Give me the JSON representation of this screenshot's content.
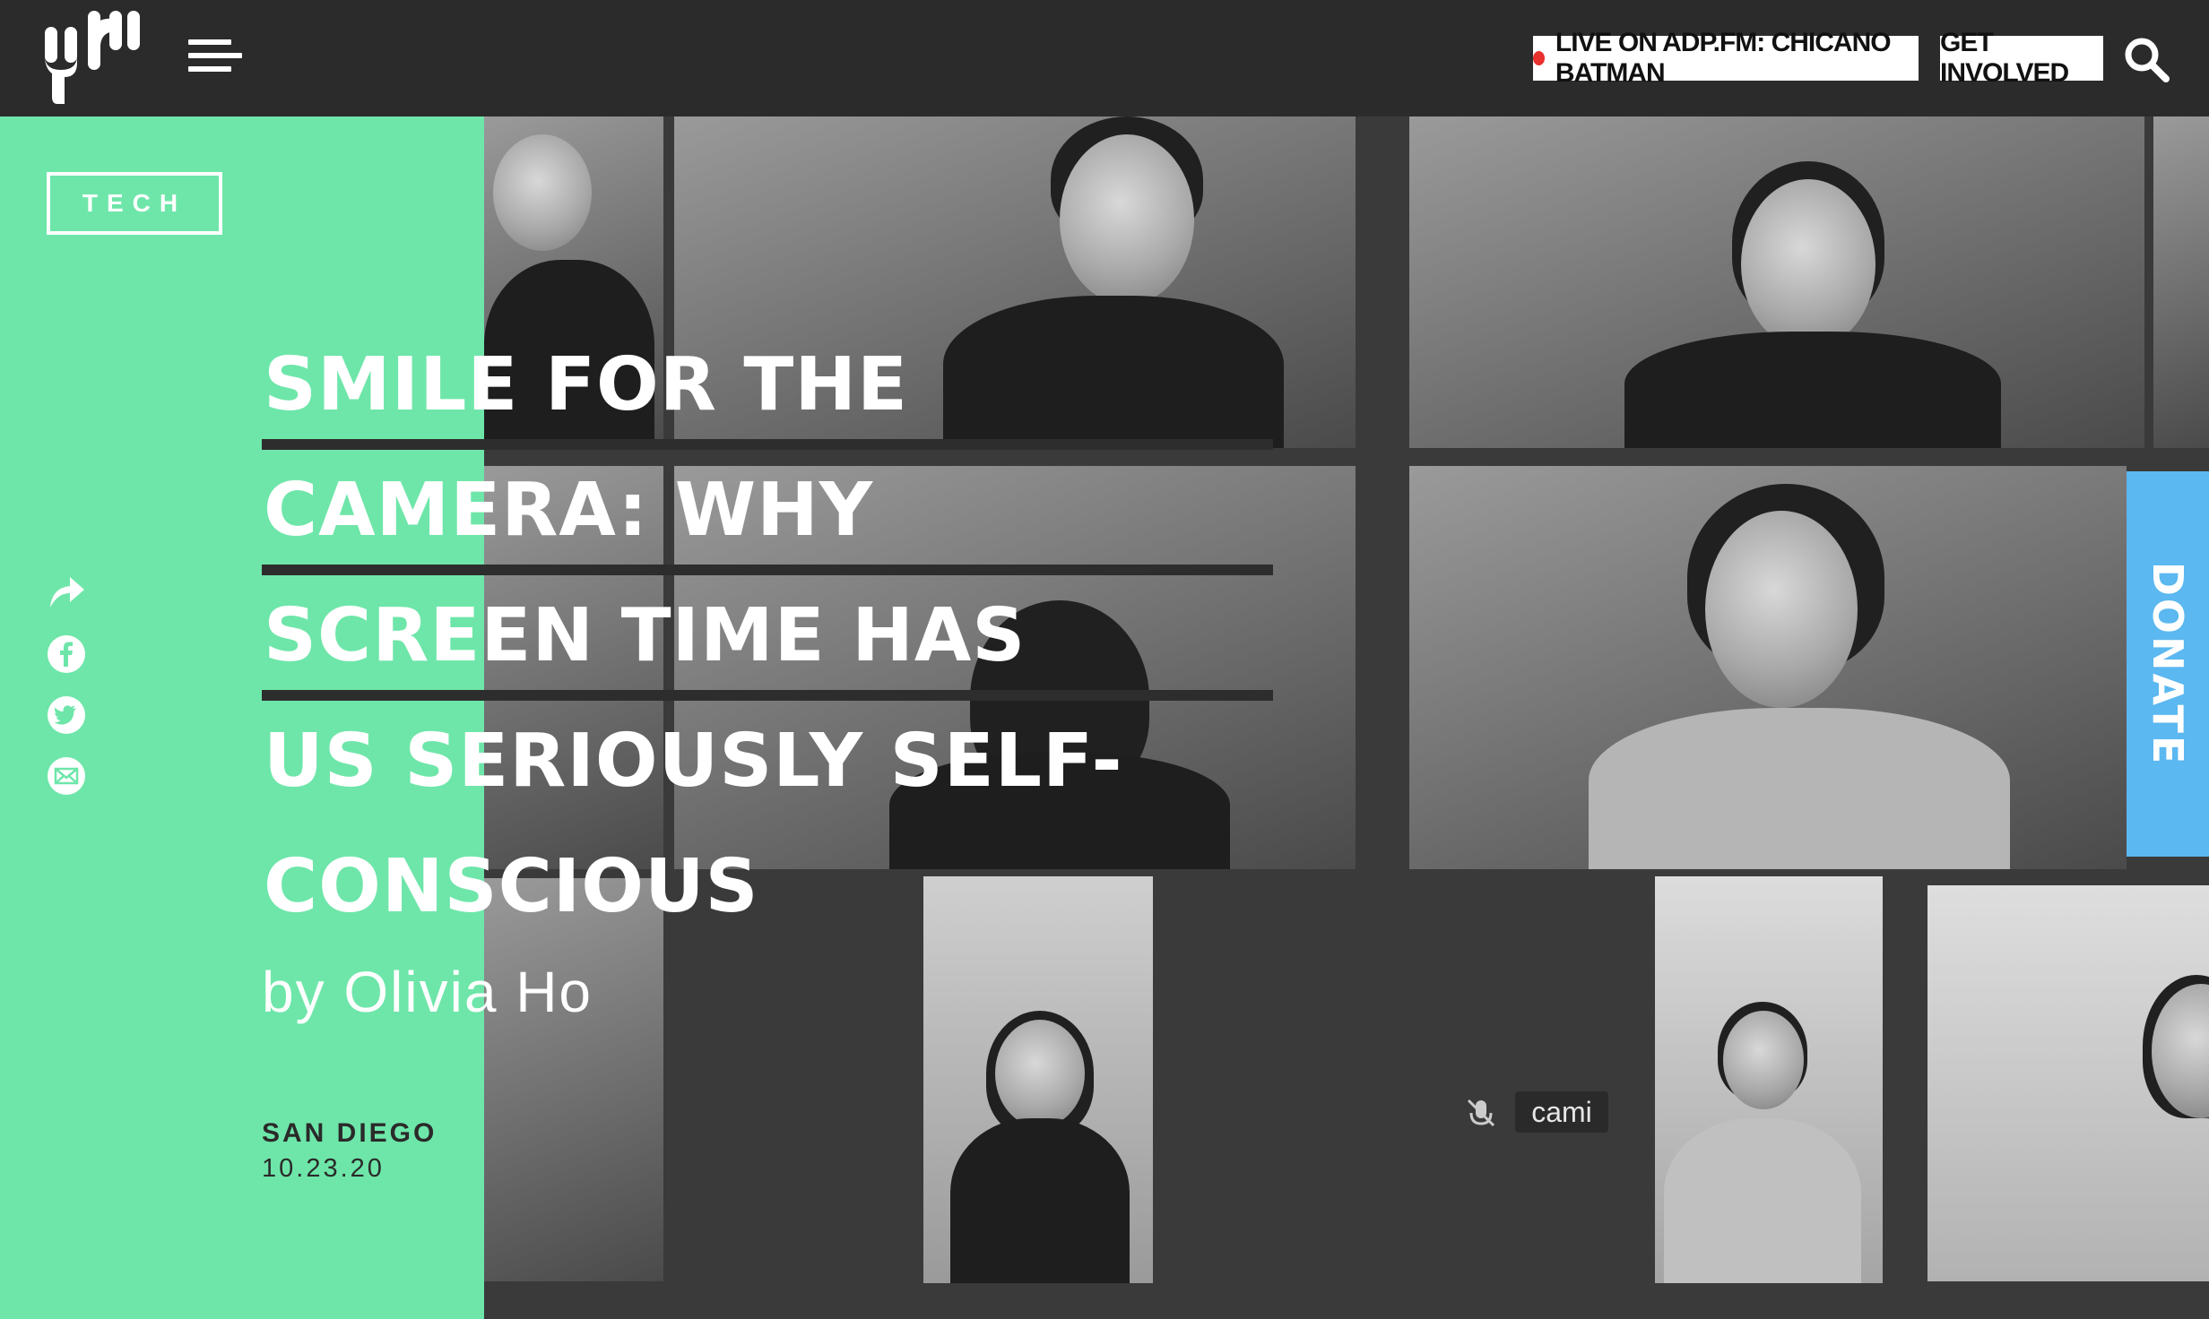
{
  "header": {
    "logo_alt": "yr",
    "live_label": "LIVE ON ADP.FM: CHICANO BATMAN",
    "get_involved_label": "GET INVOLVED"
  },
  "article": {
    "category": "TECH",
    "headline_lines": [
      "SMILE FOR THE",
      "CAMERA: WHY",
      "SCREEN TIME HAS",
      "US SERIOUSLY SELF-",
      "CONSCIOUS"
    ],
    "byline": "by Olivia Ho",
    "location": "SAN DIEGO",
    "date": "10.23.20"
  },
  "photo": {
    "participant_label": "cami"
  },
  "donate_label": "DONATE",
  "colors": {
    "green_panel": "#6ee6a9",
    "donate_blue": "#5bb8f0",
    "topbar": "#2b2b2b",
    "live_dot": "#e8302d"
  },
  "icons": [
    "menu-icon",
    "search-icon",
    "share-icon",
    "facebook-icon",
    "twitter-icon",
    "email-icon",
    "mic-muted-icon"
  ]
}
